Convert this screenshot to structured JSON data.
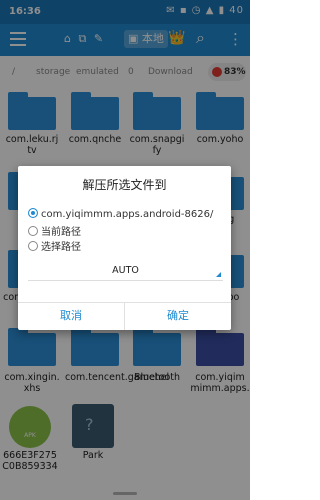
{
  "status": {
    "time": "16:36",
    "icons": "✉ ▪ ◷ ▲ ▮ 40"
  },
  "appbar": {
    "nav": "⌂ ⧉ ✎",
    "chip": "▣ 本地",
    "brand_icon": "👑",
    "search_icon": "⌕",
    "more_icon": "⋮"
  },
  "path": {
    "sep": "/",
    "seg1": "storage",
    "seg2": "emulated",
    "seg3": "0",
    "seg4": "Download",
    "storage": "83%"
  },
  "files": {
    "r1c1": "com.leku.rj tv",
    "r1c2": "com.qnche",
    "r1c3": "com.snapgi fy",
    "r1c4": "com.yoho",
    "r2c4": "oxi og",
    "r3c1": "com.qihoo.c e.bu",
    "r3c4": "ange bo",
    "r4c1": "com.xingin. xhs",
    "r4c2": "com.tencent.gamehel",
    "r4c3": "Bluetooth",
    "r4c4": "com.yiqim mimm.apps.",
    "apk_name": "666E3F275 C0B859334",
    "apk_badge": "APK",
    "park": "Park"
  },
  "dialog": {
    "title": "解压所选文件到",
    "options": [
      "com.yiqimmm.apps.android-8626/",
      "当前路径",
      "选择路径"
    ],
    "select_value": "AUTO",
    "cancel": "取消",
    "ok": "确定"
  }
}
